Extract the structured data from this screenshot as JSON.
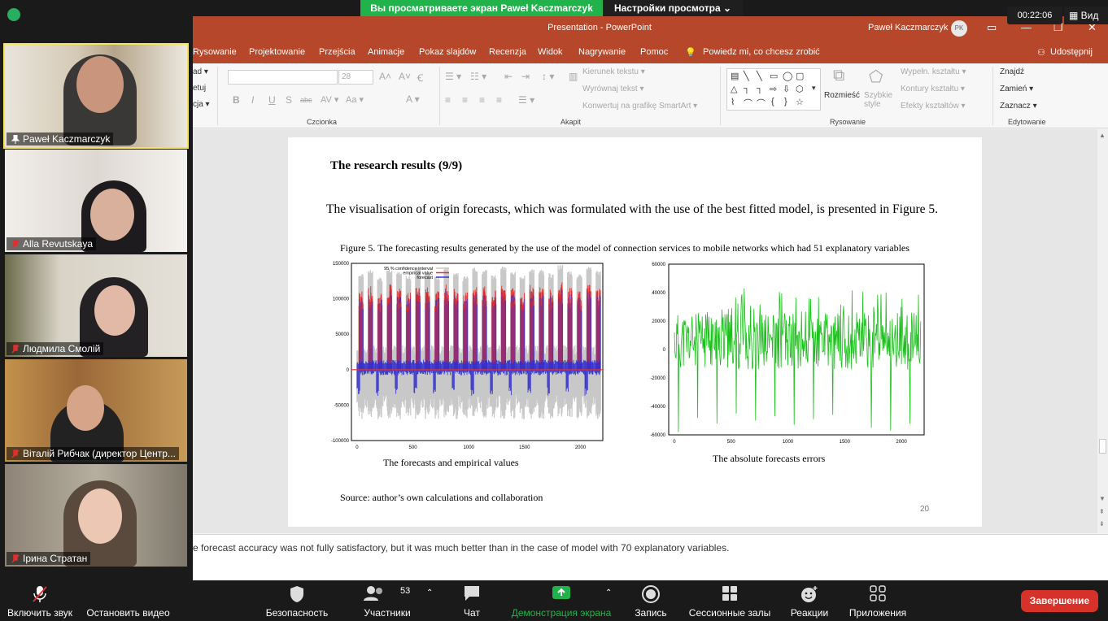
{
  "zoom": {
    "share_banner": "Вы просматриваете экран Paweł Kaczmarczyk",
    "view_options": "Настройки просмотра ⌄",
    "timer": "00:22:06",
    "view_label": "Вид",
    "participants": [
      {
        "name": "Paweł Kaczmarczyk"
      },
      {
        "name": "Alla Revutskaya"
      },
      {
        "name": "Людмила Смолій"
      },
      {
        "name": "Віталій Рибчак (директор Центр..."
      },
      {
        "name": "Ірина Стратан"
      }
    ],
    "toolbar": {
      "unmute": "Включить звук",
      "stop_video": "Остановить видео",
      "security": "Безопасность",
      "participants": "Участники",
      "participants_count": "53",
      "chat": "Чат",
      "share_screen": "Демонстрация экрана",
      "record": "Запись",
      "breakout": "Сессионные залы",
      "reactions": "Реакции",
      "apps": "Приложения",
      "end": "Завершение"
    }
  },
  "ppt": {
    "title": "Presentation  -  PowerPoint",
    "user": "Paweł Kaczmarczyk",
    "user_initials": "PK",
    "menu": [
      "Rysowanie",
      "Projektowanie",
      "Przejścia",
      "Animacje",
      "Pokaz slajdów",
      "Recenzja",
      "Widok",
      "Nagrywanie",
      "Pomoc",
      "Powiedz mi, co chcesz zrobić"
    ],
    "share_label": "Udostępnij",
    "ribbon": {
      "left_partial": [
        "ad ▾",
        "etuj",
        "cja ▾"
      ],
      "font_size": "28",
      "groups": [
        "Czcionka",
        "Akapit",
        "Rysowanie",
        "Edytowanie"
      ],
      "kierunek": "Kierunek tekstu ▾",
      "wyrownaj": "Wyrównaj tekst ▾",
      "smartart": "Konwertuj na grafikę SmartArt ▾",
      "rozmiesc": "Rozmieść",
      "szybkie": "Szybkie style",
      "wypeln": "Wypełn. kształtu ▾",
      "kontury": "Kontury kształtu ▾",
      "efekty": "Efekty kształtów ▾",
      "znajdz": "Znajdź",
      "zamien": "Zamień ▾",
      "zaznacz": "Zaznacz ▾"
    },
    "notes": "e forecast accuracy was not fully satisfactory, but it was much better than in the case of model with 70 explanatory variables."
  },
  "slide": {
    "heading": "The research results (9/9)",
    "intro": "The visualisation of origin forecasts, which was formulated with the use of the best fitted model, is presented in Figure 5.",
    "figure_caption": "Figure 5. The forecasting results generated by the use of the model of connection services to mobile networks which had 51 explanatory variables",
    "left_subtitle": "The forecasts and empirical values",
    "right_subtitle": "The absolute forecasts errors",
    "source": "Source: author’s own calculations and collaboration",
    "page_number": "20"
  },
  "chart_data": [
    {
      "type": "line",
      "series": [
        {
          "name": "95 % confidence interval",
          "color": "#c8c8c8"
        },
        {
          "name": "empirical value",
          "color": "#e03030"
        },
        {
          "name": "forecast",
          "color": "#3030d0"
        }
      ],
      "x_ticks": [
        0,
        500,
        1000,
        1500,
        2000
      ],
      "y_ticks": [
        150000,
        100000,
        50000,
        0,
        -50000,
        -100000
      ],
      "xlim": [
        -50,
        2200
      ],
      "ylim": [
        -100000,
        150000
      ],
      "legend": "top-left",
      "peak_x": [
        35,
        120,
        205,
        290,
        375,
        460,
        545,
        630,
        715,
        800,
        885,
        970,
        1055,
        1140,
        1225,
        1310,
        1395,
        1480,
        1565,
        1650,
        1735,
        1820,
        1905,
        1990,
        2075,
        2160
      ],
      "peak_values": [
        112000,
        118000,
        108000,
        121000,
        115000,
        110000,
        122000,
        117000,
        111000,
        123000,
        116000,
        109000,
        121000,
        118000,
        112000,
        124000,
        115000,
        110000,
        120000,
        118000,
        113000,
        125000,
        116000,
        111000,
        122000,
        117000
      ]
    },
    {
      "type": "line",
      "series": [
        {
          "name": "",
          "color": "#19c019"
        }
      ],
      "x_ticks": [
        0,
        500,
        1000,
        1500,
        2000
      ],
      "y_ticks": [
        60000,
        40000,
        20000,
        0,
        -20000,
        -40000,
        -60000
      ],
      "xlim": [
        -50,
        2200
      ],
      "ylim": [
        -60000,
        60000
      ],
      "dip_x": [
        35,
        205,
        375,
        545,
        715,
        885,
        1055,
        1225,
        1395,
        1565,
        1735,
        1905,
        2075
      ],
      "dip_values": [
        -58000,
        -48000,
        -52000,
        -45000,
        -50000,
        -47000,
        -53000,
        -49000,
        -46000,
        -51000,
        -55000,
        -57000,
        -52000
      ]
    }
  ]
}
